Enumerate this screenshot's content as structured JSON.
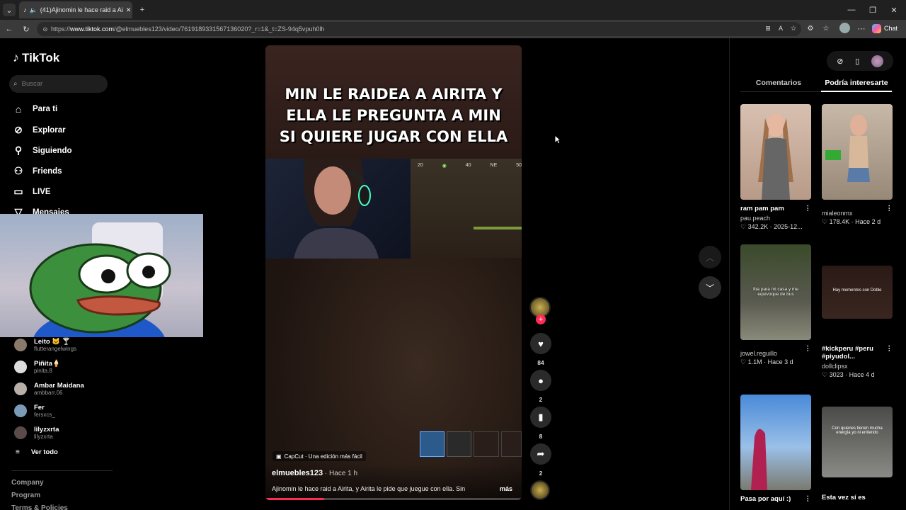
{
  "browser": {
    "tab_title": "(41)Ajinomin le hace raid a Ai",
    "url_prefix": "https://",
    "url_domain": "www.tiktok.com",
    "url_rest": "/@elmuebles123/video/7619189331567136020?_r=1&_t=ZS-94q5vpuh0lh",
    "chat_label": "Chat"
  },
  "sidebar": {
    "logo": "TikTok",
    "search_placeholder": "Buscar",
    "nav": [
      {
        "label": "Para ti",
        "icon": "home-icon"
      },
      {
        "label": "Explorar",
        "icon": "compass-icon"
      },
      {
        "label": "Siguiendo",
        "icon": "following-icon"
      },
      {
        "label": "Friends",
        "icon": "friends-icon"
      },
      {
        "label": "LIVE",
        "icon": "live-icon"
      },
      {
        "label": "Mensajes",
        "icon": "messages-icon"
      }
    ],
    "accounts": [
      {
        "name": "Leito 🐱 🍸",
        "handle": "flutterangelwings"
      },
      {
        "name": "Piñita🍦",
        "handle": "pinita.8"
      },
      {
        "name": "Ambar Maidana",
        "handle": "ambbarr.06"
      },
      {
        "name": "Fer",
        "handle": "fersxcs_"
      },
      {
        "name": "lilyzxrta",
        "handle": "lilyzxrta"
      }
    ],
    "see_all": "Ver todo",
    "footer": [
      "Company",
      "Program",
      "Terms & Policies"
    ]
  },
  "video": {
    "caption_lines": [
      "Min le raidea a Airita y",
      "ella le pregunta a min",
      "si quiere jugar con ella"
    ],
    "hud_compass": [
      "20",
      "40",
      "NE",
      "50"
    ],
    "capcut_label": "CapCut · Una edición más fácil",
    "author": "elmuebles123",
    "time": " · Hace 1 h",
    "description": "Ajinomin le hace raid a Airita, y Airita le pide que juegue con ella. Sin",
    "more": "más",
    "progress": 0.23
  },
  "actions": {
    "likes": "84",
    "comments": "2",
    "saves": "8",
    "shares": "2"
  },
  "panel": {
    "tabs": [
      "Comentarios",
      "Podría interesarte"
    ],
    "active_tab": 1,
    "cards": [
      {
        "title": "ram pam pam",
        "user": "pau.peach",
        "meta": "♡ 342.2K · 2025-12..."
      },
      {
        "title": "",
        "user": "mialeonmx",
        "meta": "♡ 178.4K · Hace 2 d"
      },
      {
        "title": "",
        "user": "jowel.reguillo",
        "meta": "♡ 1.1M · Hace 3 d",
        "overlay": "Iba para mi casa y me equivoque de bus"
      },
      {
        "title": "#kickperu #peru #piyudol...",
        "user": "dollclipsx",
        "meta": "♡ 3023 · Hace 4 d",
        "overlay": "Hay momentos con Doble"
      },
      {
        "title": "Pasa por aquí :)",
        "user": "",
        "meta": ""
      },
      {
        "title": "Esta vez sí es",
        "user": "",
        "meta": "",
        "overlay": "Con quienes tienen mucha energía yo ni entiendo"
      }
    ]
  }
}
